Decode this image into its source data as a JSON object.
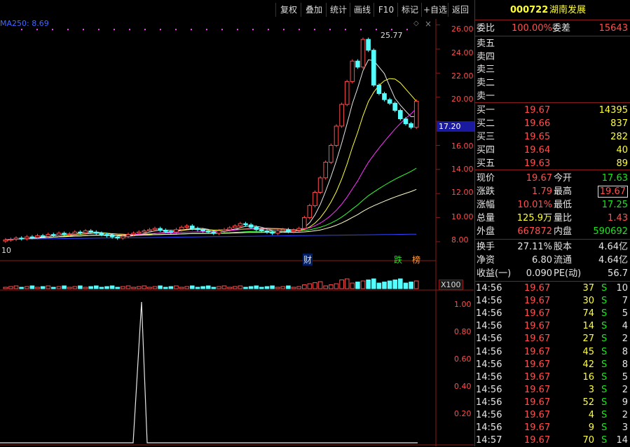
{
  "toolbar": {
    "buttons": [
      "复权",
      "叠加",
      "统计",
      "画线",
      "F10",
      "标记",
      "+自选",
      "返回"
    ]
  },
  "chart": {
    "ma_label": "MA250: 8.69",
    "peak_label": "25.77",
    "current_price_tag": "17.20",
    "low_label": "10",
    "markers": [
      "财",
      "跌",
      "榜"
    ],
    "y_ticks": [
      "26.00",
      "24.00",
      "22.00",
      "20.00",
      "18.00",
      "16.00",
      "14.00",
      "12.00",
      "10.00",
      "8.00"
    ],
    "volume_scale": "X100",
    "indicator_ticks": [
      "1.00",
      "0.80",
      "0.60",
      "0.40",
      "0.20"
    ]
  },
  "chart_data": {
    "type": "line",
    "title": "",
    "indicator": {
      "type": "line",
      "ylim": [
        0,
        1
      ],
      "spike_value": 1.0
    },
    "ylim": [
      7.3,
      26.5
    ],
    "candles_close": [
      8.15,
      8.2,
      8.3,
      8.25,
      8.4,
      8.35,
      8.5,
      8.45,
      8.6,
      8.55,
      8.7,
      8.6,
      8.65,
      8.8,
      8.75,
      8.9,
      8.8,
      8.7,
      8.6,
      8.5,
      8.4,
      8.3,
      8.45,
      8.6,
      8.7,
      8.8,
      8.9,
      9.0,
      9.1,
      8.95,
      8.85,
      8.8,
      9.0,
      9.2,
      9.3,
      9.1,
      9.0,
      8.9,
      8.8,
      8.7,
      8.9,
      9.0,
      9.15,
      9.3,
      9.5,
      9.4,
      9.2,
      9.0,
      8.9,
      8.8,
      8.7,
      8.9,
      9.0,
      8.85,
      8.95,
      9.1,
      10.0,
      11.0,
      12.1,
      13.3,
      14.6,
      16.0,
      17.6,
      19.4,
      21.3,
      23.0,
      22.5,
      24.8,
      23.9,
      21.0,
      20.3,
      19.8,
      19.5,
      18.9,
      18.2,
      17.8,
      17.5,
      19.67
    ]
  },
  "quote": {
    "code": "000722",
    "name": "湖南发展",
    "weibi_label": "委比",
    "weibi_value": "100.00%",
    "weicha_label": "委差",
    "weicha_value": "15643",
    "sell": [
      {
        "label": "卖五",
        "price": "",
        "vol": ""
      },
      {
        "label": "卖四",
        "price": "",
        "vol": ""
      },
      {
        "label": "卖三",
        "price": "",
        "vol": ""
      },
      {
        "label": "卖二",
        "price": "",
        "vol": ""
      },
      {
        "label": "卖一",
        "price": "",
        "vol": ""
      }
    ],
    "buy": [
      {
        "label": "买一",
        "price": "19.67",
        "vol": "14395"
      },
      {
        "label": "买二",
        "price": "19.66",
        "vol": "837"
      },
      {
        "label": "买三",
        "price": "19.65",
        "vol": "282"
      },
      {
        "label": "买四",
        "price": "19.64",
        "vol": "40"
      },
      {
        "label": "买五",
        "price": "19.63",
        "vol": "89"
      }
    ],
    "stats": [
      {
        "l1": "现价",
        "v1": "19.67",
        "l2": "今开",
        "v2": "17.63"
      },
      {
        "l1": "涨跌",
        "v1": "1.79",
        "l2": "最高",
        "v2": "19.67"
      },
      {
        "l1": "涨幅",
        "v1": "10.01%",
        "l2": "最低",
        "v2": "17.25"
      },
      {
        "l1": "总量",
        "v1": "125.9万",
        "l2": "量比",
        "v2": "1.43"
      },
      {
        "l1": "外盘",
        "v1": "667872",
        "l2": "内盘",
        "v2": "590692"
      }
    ],
    "extra": [
      {
        "l1": "换手",
        "v1": "27.11%",
        "l2": "股本",
        "v2": "4.64亿"
      },
      {
        "l1": "净资",
        "v1": "6.80",
        "l2": "流通",
        "v2": "4.64亿"
      },
      {
        "l1": "收益(一)",
        "v1": "0.090",
        "l2": "PE(动)",
        "v2": "56.7"
      }
    ]
  },
  "ticks": [
    {
      "time": "14:56",
      "price": "19.67",
      "vol": "37",
      "side": "S",
      "n": "10"
    },
    {
      "time": "14:56",
      "price": "19.67",
      "vol": "30",
      "side": "S",
      "n": "7"
    },
    {
      "time": "14:56",
      "price": "19.67",
      "vol": "74",
      "side": "S",
      "n": "5"
    },
    {
      "time": "14:56",
      "price": "19.67",
      "vol": "14",
      "side": "S",
      "n": "4"
    },
    {
      "time": "14:56",
      "price": "19.67",
      "vol": "27",
      "side": "S",
      "n": "2"
    },
    {
      "time": "14:56",
      "price": "19.67",
      "vol": "45",
      "side": "S",
      "n": "8"
    },
    {
      "time": "14:56",
      "price": "19.67",
      "vol": "42",
      "side": "S",
      "n": "8"
    },
    {
      "time": "14:56",
      "price": "19.67",
      "vol": "16",
      "side": "S",
      "n": "5"
    },
    {
      "time": "14:56",
      "price": "19.67",
      "vol": "3",
      "side": "S",
      "n": "2"
    },
    {
      "time": "14:56",
      "price": "19.67",
      "vol": "52",
      "side": "S",
      "n": "9"
    },
    {
      "time": "14:56",
      "price": "19.67",
      "vol": "4",
      "side": "S",
      "n": "2"
    },
    {
      "time": "14:56",
      "price": "19.67",
      "vol": "9",
      "side": "S",
      "n": "3"
    },
    {
      "time": "14:57",
      "price": "19.67",
      "vol": "70",
      "side": "S",
      "n": "14"
    }
  ]
}
